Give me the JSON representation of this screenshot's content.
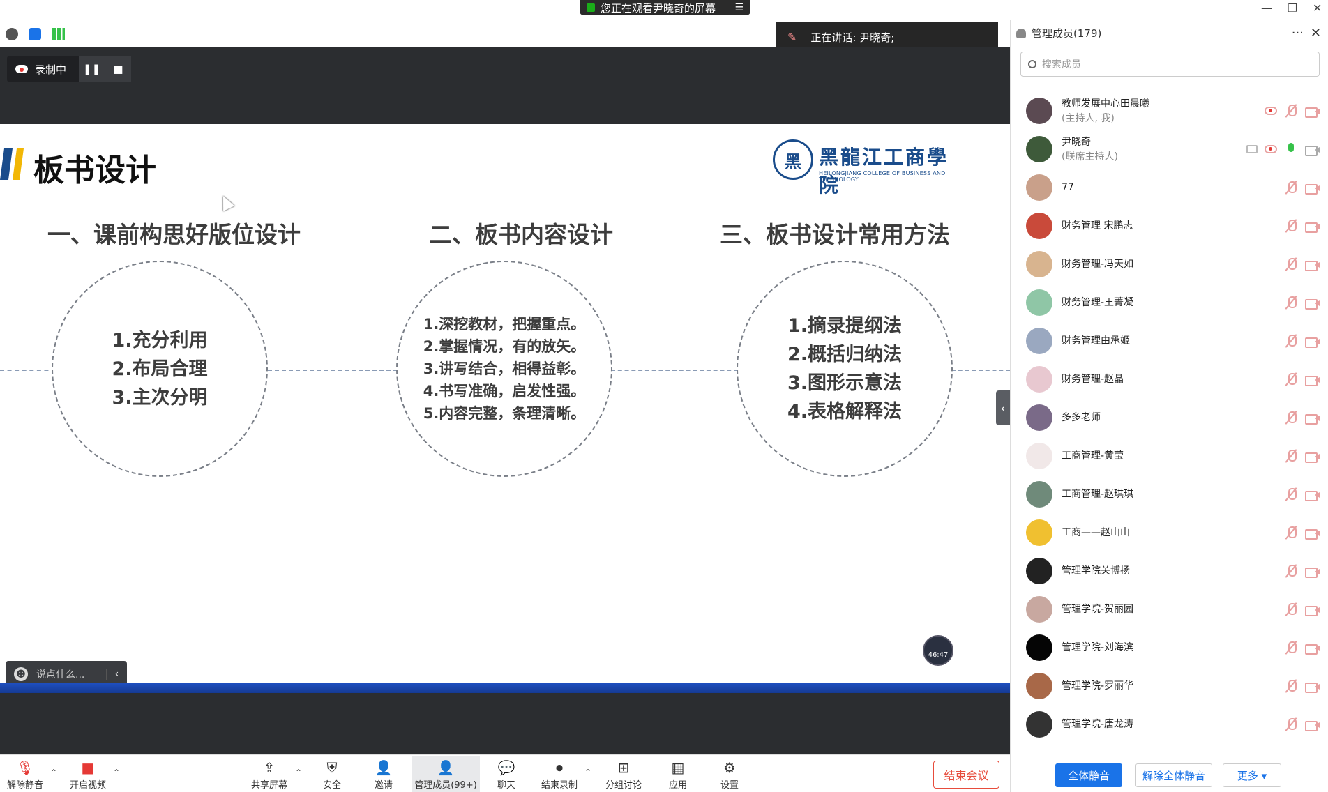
{
  "titlebar": {
    "share_notice": "您正在观看尹晓奇的屏幕",
    "minimize": "—",
    "restore": "❐",
    "close": "✕"
  },
  "speaking": {
    "label": "正在讲话: 尹晓奇;"
  },
  "recording": {
    "label": "录制中"
  },
  "slide": {
    "title": "板书设计",
    "logo": {
      "seal": "黑",
      "name": "黑龍江工商學院",
      "subtitle": "HEILONGJIANG COLLEGE OF BUSINESS AND TECHNOLOGY"
    },
    "sections": [
      {
        "heading": "一、课前构思好版位设计",
        "items": [
          "1.充分利用",
          "2.布局合理",
          "3.主次分明"
        ]
      },
      {
        "heading": "二、板书内容设计",
        "items": [
          "1.深挖教材，把握重点。",
          "2.掌握情况，有的放矢。",
          "3.讲写结合，相得益彰。",
          "4.书写准确，启发性强。",
          "5.内容完整，条理清晰。"
        ]
      },
      {
        "heading": "三、板书设计常用方法",
        "items": [
          "1.摘录提纲法",
          "2.概括归纳法",
          "3.图形示意法",
          "4.表格解释法"
        ]
      }
    ]
  },
  "timer": "46:47",
  "chat_input": {
    "placeholder": "说点什么..."
  },
  "toolbar": {
    "unmute": "解除静音",
    "start_video": "开启视频",
    "share_screen": "共享屏幕",
    "security": "安全",
    "invite": "邀请",
    "participants": "管理成员(99+)",
    "chat": "聊天",
    "end_record": "结束录制",
    "breakout": "分组讨论",
    "apps": "应用",
    "settings": "设置",
    "end_meeting": "结束会议"
  },
  "panel": {
    "title": "管理成员(179)",
    "search_placeholder": "搜索成员",
    "members": [
      {
        "name": "教师发展中心田晨曦",
        "role": "(主持人, 我)",
        "avatar": "#5b4a52"
      },
      {
        "name": "尹晓奇",
        "role": "(联席主持人)",
        "avatar": "#3e5a3a"
      },
      {
        "name": "77",
        "role": "",
        "avatar": "#c9a08a"
      },
      {
        "name": "财务管理 宋鹏志",
        "role": "",
        "avatar": "#c94a3a"
      },
      {
        "name": "财务管理-冯天如",
        "role": "",
        "avatar": "#d8b48f"
      },
      {
        "name": "财务管理-王菁凝",
        "role": "",
        "avatar": "#8fc6a6"
      },
      {
        "name": "财务管理由承姬",
        "role": "",
        "avatar": "#9aa8c0"
      },
      {
        "name": "财务管理-赵晶",
        "role": "",
        "avatar": "#e8c8d0"
      },
      {
        "name": "多多老师",
        "role": "",
        "avatar": "#7a6a88"
      },
      {
        "name": "工商管理-黄莹",
        "role": "",
        "avatar": "#f1e8e8"
      },
      {
        "name": "工商管理-赵琪琪",
        "role": "",
        "avatar": "#6f8a7a"
      },
      {
        "name": "工商——赵山山",
        "role": "",
        "avatar": "#f0c030"
      },
      {
        "name": "管理学院关博扬",
        "role": "",
        "avatar": "#222222"
      },
      {
        "name": "管理学院-贺丽园",
        "role": "",
        "avatar": "#c8a8a0"
      },
      {
        "name": "管理学院-刘海滨",
        "role": "",
        "avatar": "#050505"
      },
      {
        "name": "管理学院-罗丽华",
        "role": "",
        "avatar": "#a86848"
      },
      {
        "name": "管理学院-唐龙涛",
        "role": "",
        "avatar": "#333333"
      }
    ],
    "mute_all": "全体静音",
    "unmute_all": "解除全体静音",
    "more": "更多 ▾"
  }
}
